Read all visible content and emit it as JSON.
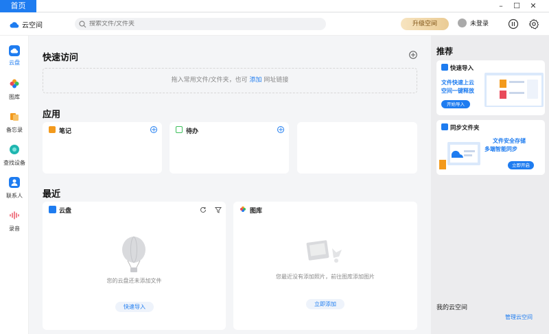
{
  "titlebar": {
    "home_tab": "首页",
    "minimize": "–",
    "maximize": "☐",
    "close": "✕"
  },
  "header": {
    "logo_text": "云空间",
    "search_placeholder": "搜索文件/文件夹",
    "upgrade_label": "升级空间",
    "user_label": "未登录"
  },
  "sidebar": {
    "items": [
      {
        "label": "云盘",
        "icon": "cloud-drive-icon",
        "color": "#1e7cf0"
      },
      {
        "label": "图库",
        "icon": "gallery-icon",
        "color": "#e94a5a"
      },
      {
        "label": "备忘录",
        "icon": "memo-icon",
        "color": "#f39a1d"
      },
      {
        "label": "查找设备",
        "icon": "find-device-icon",
        "color": "#1fb6b0"
      },
      {
        "label": "联系人",
        "icon": "contacts-icon",
        "color": "#1e7cf0"
      },
      {
        "label": "录音",
        "icon": "recorder-icon",
        "color": "#e94a5a"
      }
    ]
  },
  "main": {
    "quick_access": {
      "title": "快速访问",
      "drop_hint_before": "拖入常用文件/文件夹，也可",
      "drop_hint_link": "添加",
      "drop_hint_after": "网址链接"
    },
    "apps": {
      "title": "应用",
      "cards": [
        {
          "label": "笔记",
          "color": "#f39a1d"
        },
        {
          "label": "待办",
          "color": "#3cbf5a"
        }
      ]
    },
    "recent": {
      "title": "最近",
      "cloud": {
        "label": "云盘",
        "empty_text": "您的云盘还未添加文件",
        "action": "快速导入"
      },
      "gallery": {
        "label": "图库",
        "empty_text": "您最近没有添加照片，前往图库添加图片",
        "action": "立即添加"
      }
    }
  },
  "right_panel": {
    "title": "推荐",
    "promo1": {
      "title": "快速导入",
      "line1": "文件快速上云",
      "line2": "空间一键释放",
      "button": "开始导入"
    },
    "promo2": {
      "title": "同步文件夹",
      "line1": "文件安全存储",
      "line2": "多端智能同步",
      "button": "立即开启"
    },
    "my_cloud": "我的云空间",
    "manage": "管理云空间"
  },
  "colors": {
    "accent": "#1e7cf0",
    "upgrade": "#eacb94"
  }
}
